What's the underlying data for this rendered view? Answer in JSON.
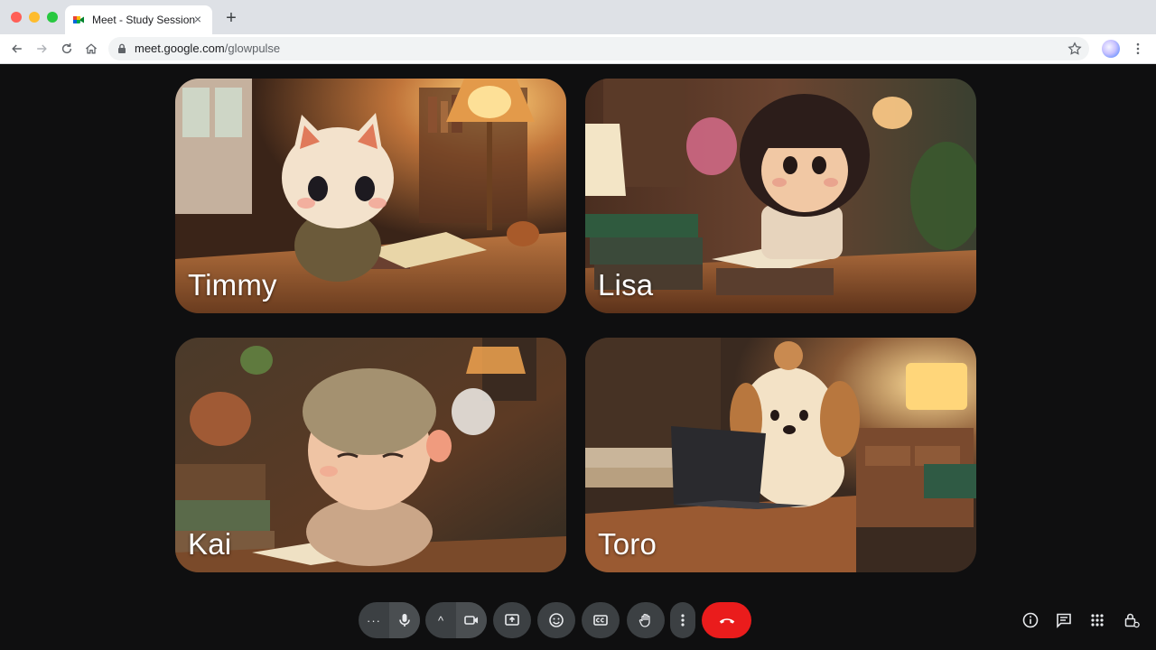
{
  "browser": {
    "tab_title": "Meet - Study Session",
    "tab_close": "×",
    "new_tab": "+",
    "url_host": "meet.google.com",
    "url_path": "/glowpulse"
  },
  "participants": [
    {
      "name": "Timmy"
    },
    {
      "name": "Lisa"
    },
    {
      "name": "Kai"
    },
    {
      "name": "Toro"
    }
  ],
  "colors": {
    "end_call": "#ea1c1c",
    "control_bg": "#3c4043",
    "stage_bg": "#0f0f10"
  },
  "controls": {
    "more_label": "···",
    "caret_label": "^"
  },
  "icons": {
    "left_controls": [
      "more-icon",
      "mic-icon",
      "caret-up-icon",
      "camera-icon",
      "present-icon",
      "emoji-icon",
      "captions-icon",
      "raise-hand-icon",
      "more-vert-icon",
      "end-call-icon"
    ],
    "right_controls": [
      "info-icon",
      "chat-icon",
      "apps-icon",
      "host-controls-icon"
    ]
  }
}
